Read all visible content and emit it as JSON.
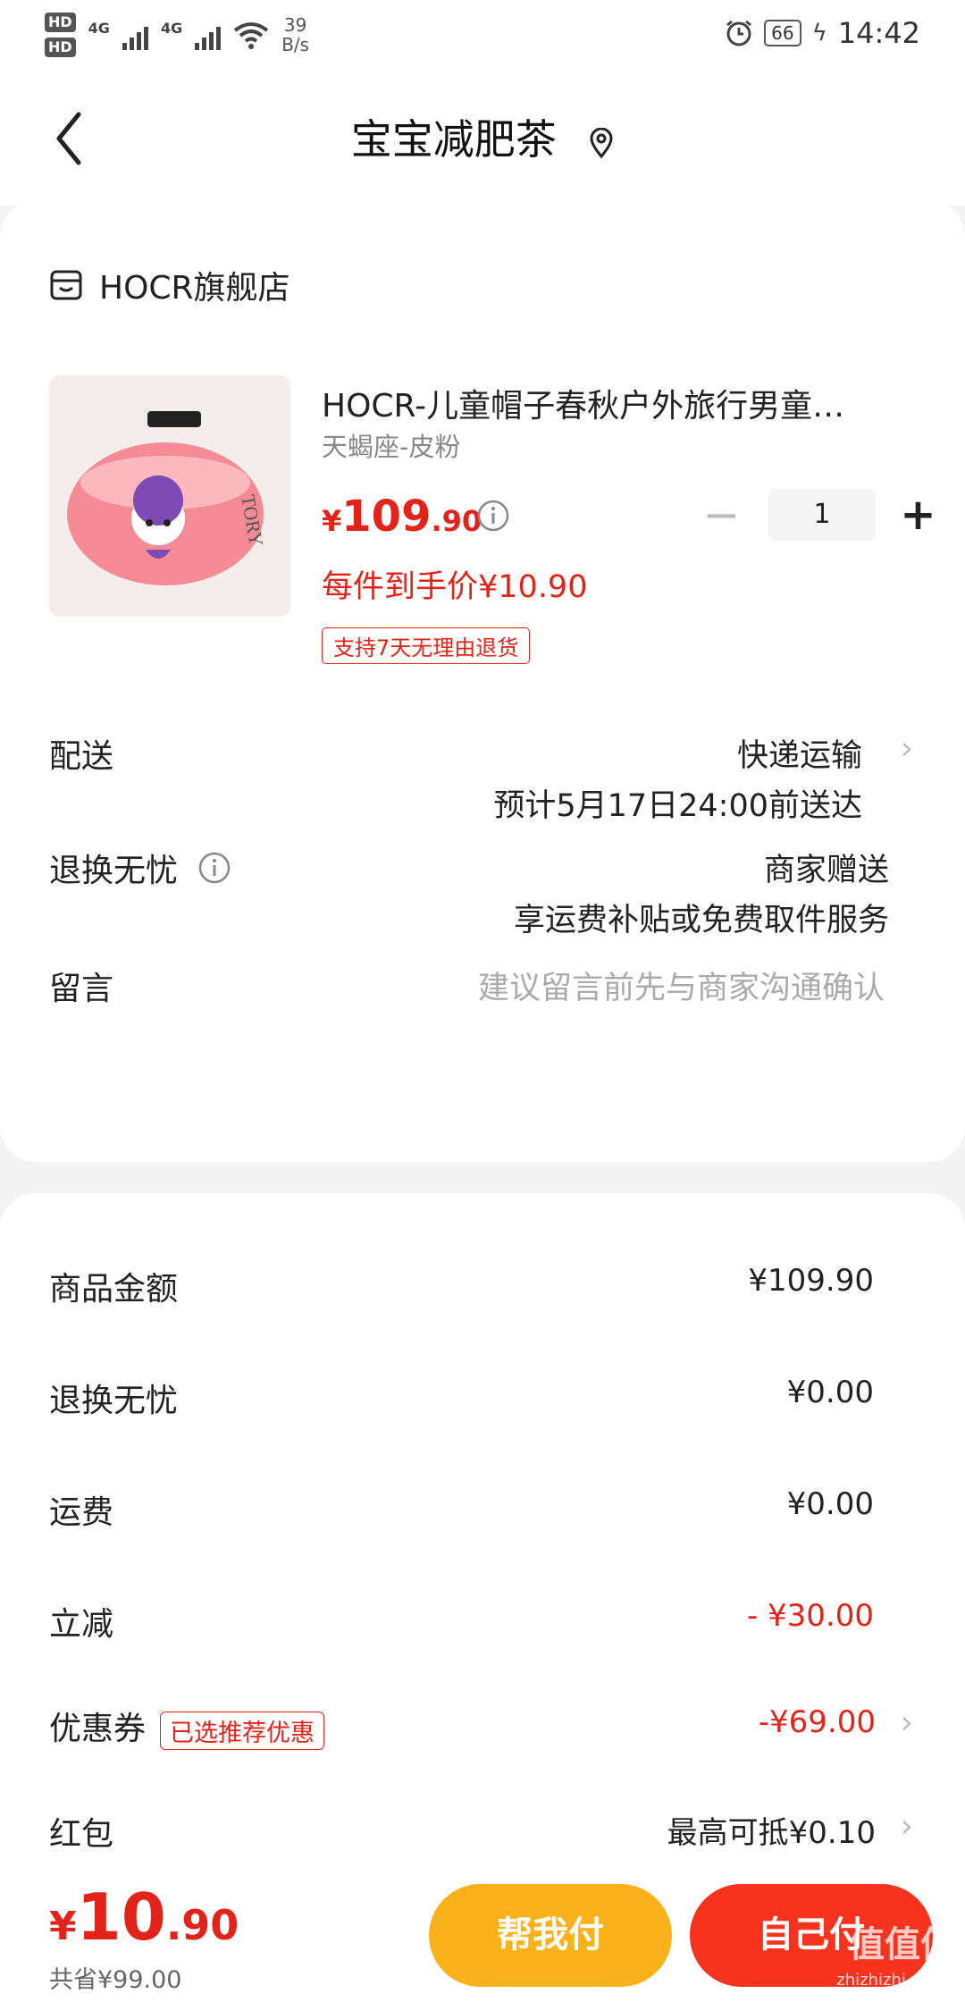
{
  "status_bar": {
    "hd1": "HD",
    "hd2": "HD",
    "net1": "4G",
    "net2": "4G",
    "speed_value": "39",
    "speed_unit": "B/s",
    "battery": "66",
    "time": "14:42"
  },
  "header": {
    "title": "宝宝减肥茶"
  },
  "store": {
    "name": "HOCR旗舰店"
  },
  "product": {
    "title": "HOCR-儿童帽子春秋户外旅行男童…",
    "spec": "天蝎座-皮粉",
    "price_symbol": "¥",
    "price_int": "109",
    "price_dec": ".90",
    "quantity": "1",
    "per_price": "每件到手价¥10.90",
    "return_badge": "支持7天无理由退货"
  },
  "delivery": {
    "label": "配送",
    "method": "快递运输",
    "eta": "预计5月17日24:00前送达"
  },
  "return_worry": {
    "label": "退换无忧",
    "value": "商家赠送",
    "desc": "享运费补贴或免费取件服务"
  },
  "message": {
    "label": "留言",
    "placeholder": "建议留言前先与商家沟通确认"
  },
  "summary": {
    "goods_label": "商品金额",
    "goods_value": "¥109.90",
    "return_label": "退换无忧",
    "return_value": "¥0.00",
    "shipping_label": "运费",
    "shipping_value": "¥0.00",
    "discount_label": "立减",
    "discount_value": "- ¥30.00",
    "coupon_label": "优惠券",
    "coupon_badge": "已选推荐优惠",
    "coupon_value": "-¥69.00",
    "redpacket_label": "红包",
    "redpacket_value": "最高可抵¥0.10"
  },
  "bottom": {
    "total_symbol": "¥",
    "total_int": "10",
    "total_dec": ".90",
    "saved": "共省¥99.00",
    "help_pay": "帮我付",
    "self_pay": "自己付",
    "watermark": "值值值",
    "watermark_url": "zhizhizhi.com"
  },
  "colors": {
    "accent_red": "#e2231a",
    "help_button": "#fbb21a",
    "self_button": "#f5331e"
  }
}
